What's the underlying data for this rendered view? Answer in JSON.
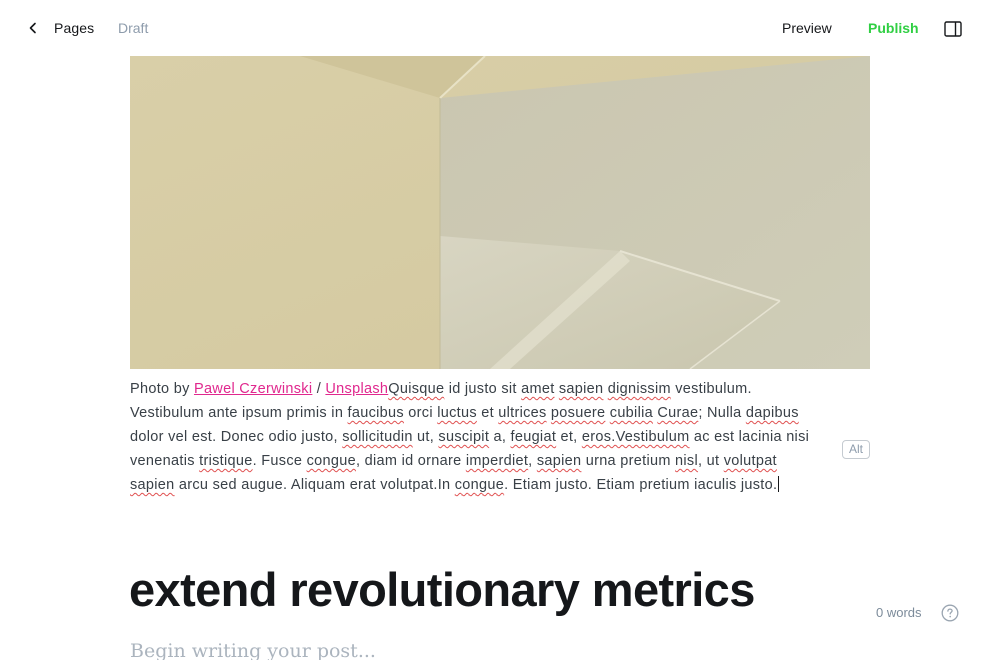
{
  "header": {
    "back_label": "Pages",
    "status": "Draft",
    "preview_label": "Preview",
    "publish_label": "Publish"
  },
  "feature_image": {
    "caption": {
      "prefix": "Photo by ",
      "author": "Pawel Czerwinski",
      "separator": " / ",
      "source": "Unsplash",
      "segments": [
        {
          "t": "Quisque",
          "s": true
        },
        {
          "t": " id justo sit "
        },
        {
          "t": "amet",
          "s": true
        },
        {
          "t": " "
        },
        {
          "t": "sapien",
          "s": true
        },
        {
          "t": " "
        },
        {
          "t": "dignissim",
          "s": true
        },
        {
          "t": " vestibulum. Vestibulum ante ipsum primis in "
        },
        {
          "t": "faucibus",
          "s": true
        },
        {
          "t": " orci "
        },
        {
          "t": "luctus",
          "s": true
        },
        {
          "t": " et "
        },
        {
          "t": "ultrices",
          "s": true
        },
        {
          "t": " "
        },
        {
          "t": "posuere",
          "s": true
        },
        {
          "t": " "
        },
        {
          "t": "cubilia",
          "s": true
        },
        {
          "t": " "
        },
        {
          "t": "Curae",
          "s": true
        },
        {
          "t": "; Nulla "
        },
        {
          "t": "dapibus",
          "s": true
        },
        {
          "t": " dolor vel est. Donec odio justo, "
        },
        {
          "t": "sollicitudin",
          "s": true
        },
        {
          "t": " ut, "
        },
        {
          "t": "suscipit",
          "s": true
        },
        {
          "t": " a, "
        },
        {
          "t": "feugiat",
          "s": true
        },
        {
          "t": " et, "
        },
        {
          "t": "eros.Vestibulum",
          "s": true
        },
        {
          "t": " ac est lacinia nisi venenatis "
        },
        {
          "t": "tristique",
          "s": true
        },
        {
          "t": ". Fusce "
        },
        {
          "t": "congue",
          "s": true
        },
        {
          "t": ", diam id ornare "
        },
        {
          "t": "imperdiet",
          "s": true
        },
        {
          "t": ", "
        },
        {
          "t": "sapien",
          "s": true
        },
        {
          "t": " urna pretium "
        },
        {
          "t": "nisl",
          "s": true
        },
        {
          "t": ", ut "
        },
        {
          "t": "volutpat",
          "s": true
        },
        {
          "t": " "
        },
        {
          "t": "sapien",
          "s": true
        },
        {
          "t": " arcu sed augue. Aliquam erat volutpat.In "
        },
        {
          "t": "congue",
          "s": true
        },
        {
          "t": ". Etiam justo. Etiam pretium iaculis justo."
        }
      ]
    },
    "alt_label": "Alt"
  },
  "post": {
    "title": "extend revolutionary metrics",
    "body_placeholder": "Begin writing your post..."
  },
  "footer": {
    "word_count": "0 words"
  },
  "colors": {
    "accent_green": "#30cf43",
    "link_pink": "#e0288e",
    "muted": "#8e9cac"
  },
  "icons": {
    "back": "chevron-left-icon",
    "sidebar": "sidebar-panel-icon",
    "help": "question-circle-icon"
  }
}
